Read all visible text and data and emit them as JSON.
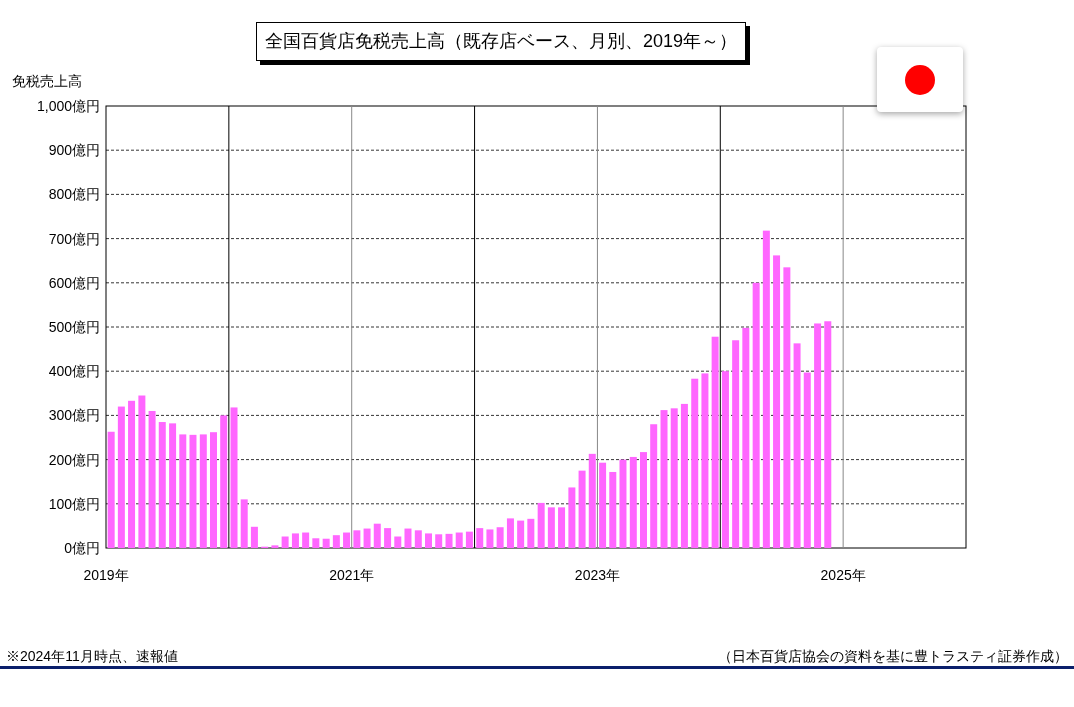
{
  "title": "全国百貨店免税売上高（既存店ベース、月別、2019年～）",
  "flag": {
    "kind": "japan"
  },
  "chart_data": {
    "type": "bar",
    "ylabel": "免税売上高",
    "grid": true,
    "x": [
      2019.042,
      2019.125,
      2019.208,
      2019.292,
      2019.375,
      2019.458,
      2019.542,
      2019.625,
      2019.708,
      2019.792,
      2019.875,
      2019.958,
      2020.042,
      2020.125,
      2020.208,
      2020.292,
      2020.375,
      2020.458,
      2020.542,
      2020.625,
      2020.708,
      2020.792,
      2020.875,
      2020.958,
      2021.042,
      2021.125,
      2021.208,
      2021.292,
      2021.375,
      2021.458,
      2021.542,
      2021.625,
      2021.708,
      2021.792,
      2021.875,
      2021.958,
      2022.042,
      2022.125,
      2022.208,
      2022.292,
      2022.375,
      2022.458,
      2022.542,
      2022.625,
      2022.708,
      2022.792,
      2022.875,
      2022.958,
      2023.042,
      2023.125,
      2023.208,
      2023.292,
      2023.375,
      2023.458,
      2023.542,
      2023.625,
      2023.708,
      2023.792,
      2023.875,
      2023.958,
      2024.042,
      2024.125,
      2024.208,
      2024.292,
      2024.375,
      2024.458,
      2024.542,
      2024.625,
      2024.708,
      2024.792,
      2024.875
    ],
    "series": [
      {
        "color": "#ff66ff",
        "values": [
          263,
          320,
          333,
          345,
          310,
          285,
          282,
          257,
          256,
          257,
          262,
          300,
          318,
          110,
          48,
          3,
          6,
          26,
          33,
          35,
          22,
          21,
          29,
          35,
          40,
          44,
          55,
          45,
          26,
          44,
          40,
          33,
          31,
          32,
          35,
          37,
          45,
          42,
          47,
          67,
          62,
          66,
          102,
          92,
          92,
          137,
          175,
          213,
          193,
          172,
          200,
          206,
          217,
          280,
          312,
          316,
          326,
          383,
          395,
          478,
          400,
          470,
          498,
          600,
          718,
          662,
          635,
          463,
          397,
          508,
          513
        ]
      }
    ],
    "xlim": [
      2019,
      2026
    ],
    "ylim": [
      0,
      1000
    ],
    "yticks": [
      {
        "value": 0,
        "label": "0億円"
      },
      {
        "value": 100,
        "label": "100億円"
      },
      {
        "value": 200,
        "label": "200億円"
      },
      {
        "value": 300,
        "label": "300億円"
      },
      {
        "value": 400,
        "label": "400億円"
      },
      {
        "value": 500,
        "label": "500億円"
      },
      {
        "value": 600,
        "label": "600億円"
      },
      {
        "value": 700,
        "label": "700億円"
      },
      {
        "value": 800,
        "label": "800億円"
      },
      {
        "value": 900,
        "label": "900億円"
      },
      {
        "value": 1000,
        "label": "1,000億円"
      }
    ],
    "xticks": [
      {
        "value": 2019,
        "label": "2019年"
      },
      {
        "value": 2021,
        "label": "2021年"
      },
      {
        "value": 2023,
        "label": "2023年"
      },
      {
        "value": 2025,
        "label": "2025年"
      }
    ]
  },
  "note": "※2024年11月時点、速報値",
  "source": "（日本百貨店協会の資料を基に豊トラスティ証券作成）"
}
